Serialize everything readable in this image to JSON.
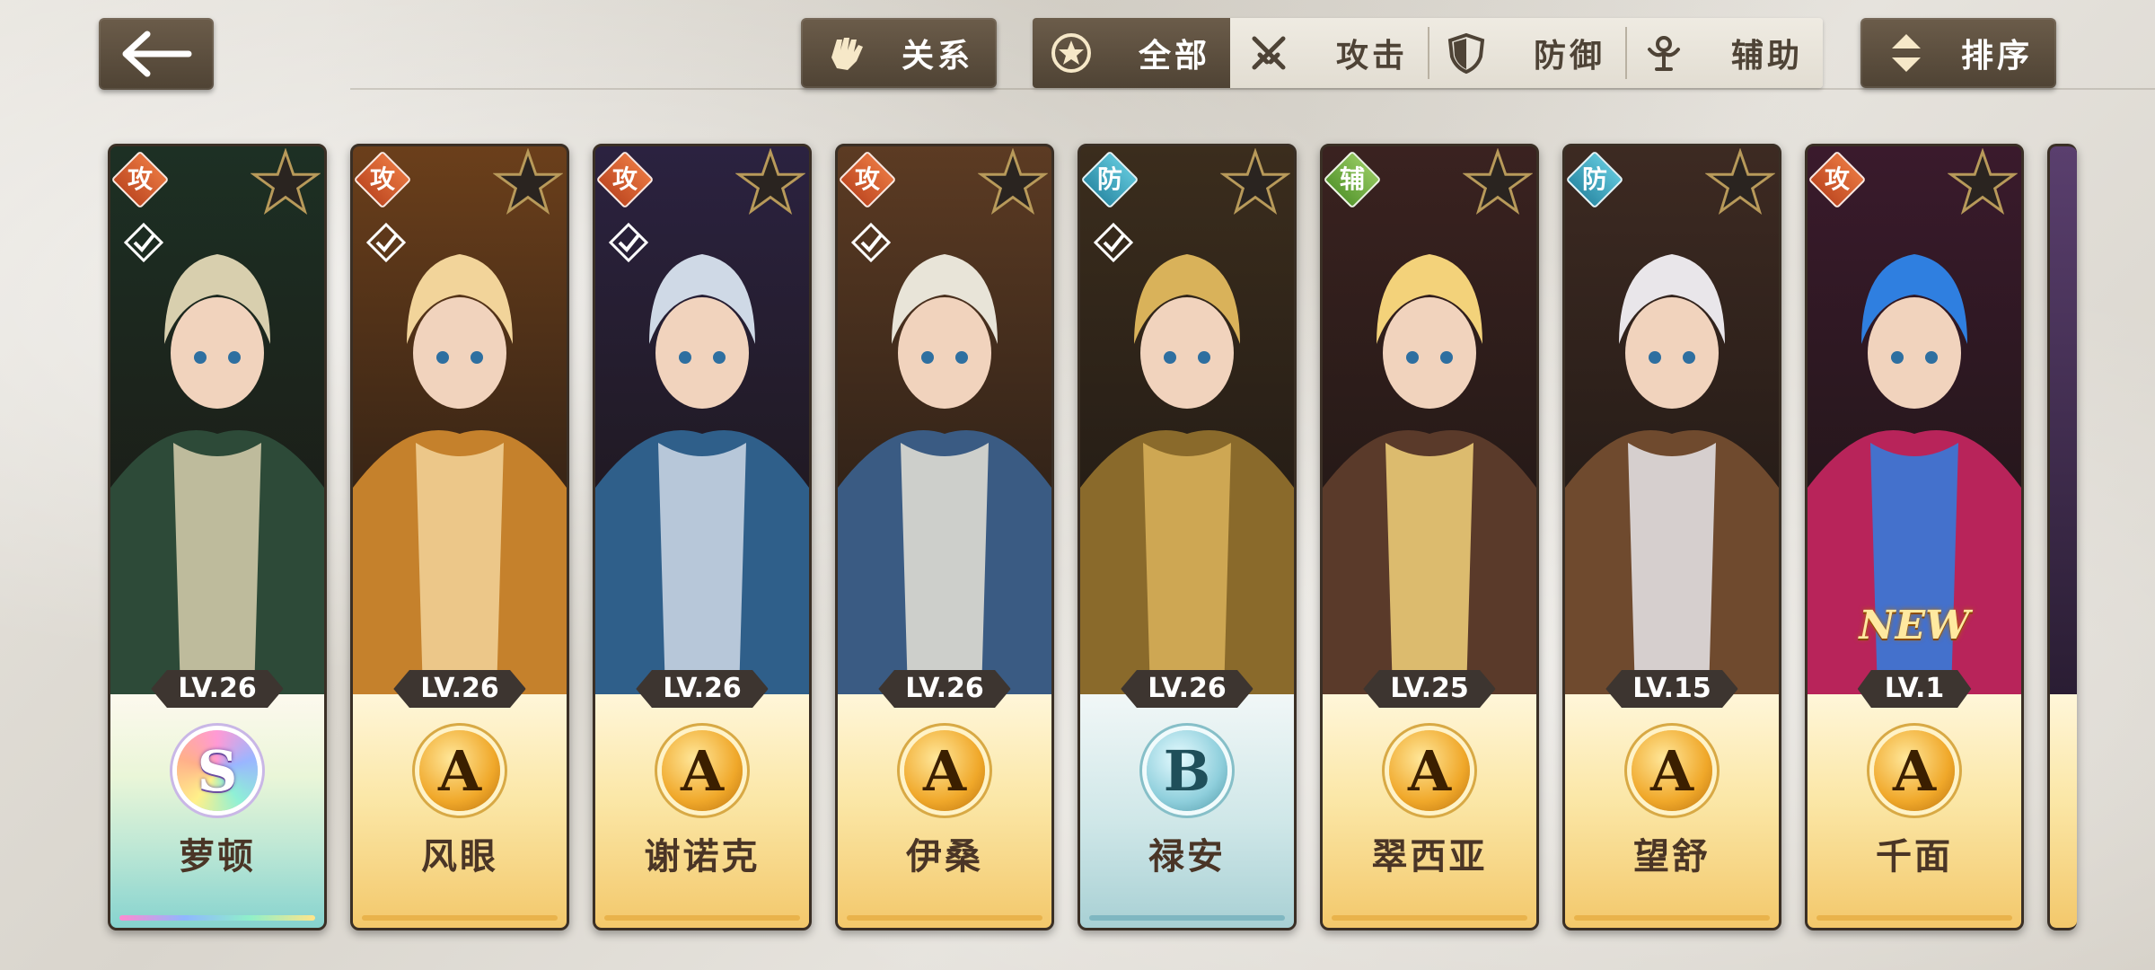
{
  "nav": {
    "back_icon": "arrow-left-icon"
  },
  "relation_button": {
    "label": "关系",
    "icon": "gauntlet-icon"
  },
  "filter_tabs": [
    {
      "label": "全部",
      "icon": "star-circle-icon",
      "active": true
    },
    {
      "label": "攻击",
      "icon": "crossed-swords-icon",
      "active": false
    },
    {
      "label": "防御",
      "icon": "shield-icon",
      "active": false
    },
    {
      "label": "辅助",
      "icon": "support-figure-icon",
      "active": false
    }
  ],
  "sort_button": {
    "label": "排序",
    "icon": "sort-arrows-icon"
  },
  "characters": [
    {
      "name": "萝顿",
      "role": "攻",
      "role_type": "atk",
      "level": "LV.26",
      "rank": "S",
      "checked": true,
      "new": false,
      "palette": [
        "#2d4a38",
        "#d8cfae",
        "#1d3024"
      ]
    },
    {
      "name": "风眼",
      "role": "攻",
      "role_type": "atk",
      "level": "LV.26",
      "rank": "A",
      "checked": true,
      "new": false,
      "palette": [
        "#c5812c",
        "#f2d49a",
        "#6b3f1b"
      ]
    },
    {
      "name": "谢诺克",
      "role": "攻",
      "role_type": "atk",
      "level": "LV.26",
      "rank": "A",
      "checked": true,
      "new": false,
      "palette": [
        "#2f5f8a",
        "#cfd9e6",
        "#2b2240"
      ]
    },
    {
      "name": "伊桑",
      "role": "攻",
      "role_type": "atk",
      "level": "LV.26",
      "rank": "A",
      "checked": true,
      "new": false,
      "palette": [
        "#3a5b83",
        "#e8e4d8",
        "#5c3b23"
      ]
    },
    {
      "name": "禄安",
      "role": "防",
      "role_type": "def",
      "level": "LV.26",
      "rank": "B",
      "checked": true,
      "new": false,
      "palette": [
        "#8a6a2b",
        "#d9b25a",
        "#3b2d1d"
      ]
    },
    {
      "name": "翠西亚",
      "role": "辅",
      "role_type": "sup",
      "level": "LV.25",
      "rank": "A",
      "checked": false,
      "new": false,
      "palette": [
        "#5a3a2a",
        "#f3d27a",
        "#3a2220"
      ]
    },
    {
      "name": "望舒",
      "role": "防",
      "role_type": "def",
      "level": "LV.15",
      "rank": "A",
      "checked": false,
      "new": false,
      "palette": [
        "#6f4a2e",
        "#e9e6ea",
        "#3d2a22"
      ]
    },
    {
      "name": "千面",
      "role": "攻",
      "role_type": "atk",
      "level": "LV.1",
      "rank": "A",
      "checked": false,
      "new": true,
      "new_label": "NEW",
      "palette": [
        "#b8245a",
        "#2f7fe0",
        "#3a1a2c"
      ]
    }
  ]
}
